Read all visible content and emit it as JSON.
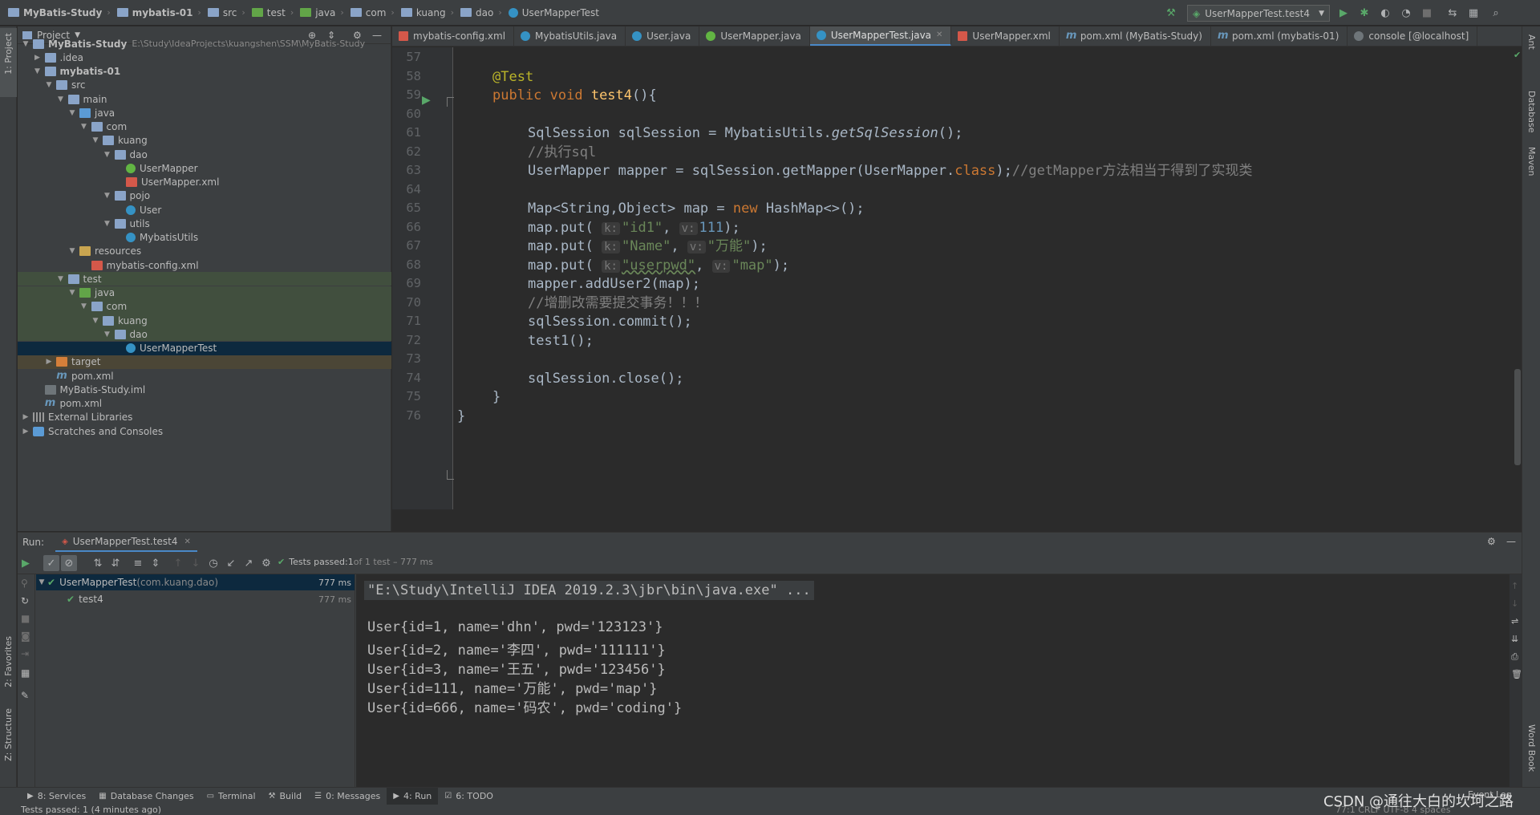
{
  "breadcrumbs": [
    {
      "label": "MyBatis-Study",
      "bold": true
    },
    {
      "label": "mybatis-01",
      "bold": true
    },
    {
      "label": "src"
    },
    {
      "label": "test"
    },
    {
      "label": "java"
    },
    {
      "label": "com"
    },
    {
      "label": "kuang"
    },
    {
      "label": "dao"
    },
    {
      "label": "UserMapperTest"
    }
  ],
  "run_config": "UserMapperTest.test4",
  "left_tabs": {
    "project": "1: Project",
    "favorites": "2: Favorites",
    "structure": "Z: Structure"
  },
  "right_tabs": {
    "ant": "Ant",
    "database": "Database",
    "maven": "Maven",
    "wordbook": "Word Book"
  },
  "project": {
    "header": "Project",
    "root_path": "E:\\Study\\IdeaProjects\\kuangshen\\SSM\\MyBatis-Study",
    "tree": [
      {
        "label": "MyBatis-Study",
        "depth": 0,
        "arrow": "down",
        "icon": "folder",
        "bold": true
      },
      {
        "label": ".idea",
        "depth": 1,
        "arrow": "right",
        "icon": "folder"
      },
      {
        "label": "mybatis-01",
        "depth": 1,
        "arrow": "down",
        "icon": "folder",
        "bold": true
      },
      {
        "label": "src",
        "depth": 2,
        "arrow": "down",
        "icon": "folder"
      },
      {
        "label": "main",
        "depth": 3,
        "arrow": "down",
        "icon": "folder"
      },
      {
        "label": "java",
        "depth": 4,
        "arrow": "down",
        "icon": "folder-src"
      },
      {
        "label": "com",
        "depth": 5,
        "arrow": "down",
        "icon": "folder"
      },
      {
        "label": "kuang",
        "depth": 6,
        "arrow": "down",
        "icon": "folder"
      },
      {
        "label": "dao",
        "depth": 7,
        "arrow": "down",
        "icon": "folder"
      },
      {
        "label": "UserMapper",
        "depth": 8,
        "arrow": "",
        "icon": "interface"
      },
      {
        "label": "UserMapper.xml",
        "depth": 8,
        "arrow": "",
        "icon": "xml"
      },
      {
        "label": "pojo",
        "depth": 7,
        "arrow": "down",
        "icon": "folder"
      },
      {
        "label": "User",
        "depth": 8,
        "arrow": "",
        "icon": "class"
      },
      {
        "label": "utils",
        "depth": 7,
        "arrow": "down",
        "icon": "folder"
      },
      {
        "label": "MybatisUtils",
        "depth": 8,
        "arrow": "",
        "icon": "class"
      },
      {
        "label": "resources",
        "depth": 4,
        "arrow": "down",
        "icon": "folder-res"
      },
      {
        "label": "mybatis-config.xml",
        "depth": 5,
        "arrow": "",
        "icon": "xml"
      },
      {
        "label": "test",
        "depth": 3,
        "arrow": "down",
        "icon": "folder",
        "hl": "green"
      },
      {
        "label": "java",
        "depth": 4,
        "arrow": "down",
        "icon": "folder-test",
        "hl": "green"
      },
      {
        "label": "com",
        "depth": 5,
        "arrow": "down",
        "icon": "folder",
        "hl": "green"
      },
      {
        "label": "kuang",
        "depth": 6,
        "arrow": "down",
        "icon": "folder",
        "hl": "green"
      },
      {
        "label": "dao",
        "depth": 7,
        "arrow": "down",
        "icon": "folder",
        "hl": "green"
      },
      {
        "label": "UserMapperTest",
        "depth": 8,
        "arrow": "",
        "icon": "class",
        "hl": "sel"
      },
      {
        "label": "target",
        "depth": 2,
        "arrow": "right",
        "icon": "folder-target",
        "hl": "brown"
      },
      {
        "label": "pom.xml",
        "depth": 2,
        "arrow": "",
        "icon": "maven"
      },
      {
        "label": "MyBatis-Study.iml",
        "depth": 1,
        "arrow": "",
        "icon": "iml"
      },
      {
        "label": "pom.xml",
        "depth": 1,
        "arrow": "",
        "icon": "maven"
      },
      {
        "label": "External Libraries",
        "depth": 0,
        "arrow": "right",
        "icon": "lib"
      },
      {
        "label": "Scratches and Consoles",
        "depth": 0,
        "arrow": "right",
        "icon": "scratch"
      }
    ]
  },
  "editor_tabs": [
    {
      "label": "mybatis-config.xml",
      "icon": "xml"
    },
    {
      "label": "MybatisUtils.java",
      "icon": "class"
    },
    {
      "label": "User.java",
      "icon": "class"
    },
    {
      "label": "UserMapper.java",
      "icon": "interface"
    },
    {
      "label": "UserMapperTest.java",
      "icon": "class",
      "active": true
    },
    {
      "label": "UserMapper.xml",
      "icon": "xml"
    },
    {
      "label": "pom.xml (MyBatis-Study)",
      "icon": "maven"
    },
    {
      "label": "pom.xml (mybatis-01)",
      "icon": "maven"
    },
    {
      "label": "console [@localhost]",
      "icon": "console"
    }
  ],
  "code": {
    "line_numbers": [
      "57",
      "58",
      "59",
      "60",
      "61",
      "62",
      "63",
      "64",
      "65",
      "66",
      "67",
      "68",
      "69",
      "70",
      "71",
      "72",
      "73",
      "74",
      "75",
      "76"
    ],
    "l58_annotation": "@Test",
    "l59_kw": "public void ",
    "l59_fn": "test4",
    "l59_rest": "(){",
    "l61_a": "SqlSession sqlSession = MybatisUtils.",
    "l61_it": "getSqlSession",
    "l61_b": "();",
    "l62_comment": "//执行sql",
    "l63_a": "UserMapper mapper = sqlSession.getMapper(UserMapper.",
    "l63_kw": "class",
    "l63_b": ");",
    "l63_comment": "//getMapper方法相当于得到了实现类",
    "l65_a": "Map<String,Object> map = ",
    "l65_kw": "new ",
    "l65_b": "HashMap<>();",
    "put_prefix": "map.put( ",
    "hint_k": "k:",
    "hint_v": "v:",
    "l66_k": "\"id1\"",
    "l66_v": "111",
    "l67_k": "\"Name\"",
    "l67_v": "\"万能\"",
    "l68_k": "\"userpwd\"",
    "l68_v": "\"map\"",
    "comma": ", ",
    "close_paren": ");",
    "l69": "mapper.addUser2(map);",
    "l70_comment": "//增删改需要提交事务！！！",
    "l71": "sqlSession.commit();",
    "l72": "test1();",
    "l74": "sqlSession.close();",
    "l75": "}",
    "l76": "}"
  },
  "run": {
    "label": "Run:",
    "tab": "UserMapperTest.test4",
    "status_prefix": "Tests passed: ",
    "status_count": "1",
    "status_suffix": " of 1 test – 777 ms",
    "tree": [
      {
        "label": "UserMapperTest",
        "sub": " (com.kuang.dao)",
        "time": "777 ms"
      },
      {
        "label": "test4",
        "sub": "",
        "time": "777 ms"
      }
    ],
    "console": [
      "\"E:\\Study\\IntelliJ IDEA 2019.2.3\\jbr\\bin\\java.exe\" ...",
      "",
      "User{id=1, name='dhn', pwd='123123'}",
      "User{id=2, name='李四', pwd='111111'}",
      "User{id=3, name='王五', pwd='123456'}",
      "User{id=111, name='万能', pwd='map'}",
      "User{id=666, name='码农', pwd='coding'}"
    ]
  },
  "bottom_tabs": [
    {
      "label": "8: Services"
    },
    {
      "label": "Database Changes"
    },
    {
      "label": "Terminal"
    },
    {
      "label": "Build"
    },
    {
      "label": "0: Messages"
    },
    {
      "label": "4: Run",
      "active": true
    },
    {
      "label": "6: TODO"
    }
  ],
  "event_log": "Event Log",
  "status_bar": {
    "message": "Tests passed: 1 (4 minutes ago)",
    "right": "77:1  CRLF  UTF-8  4 spaces"
  },
  "watermark": "CSDN @通往大白的坎坷之路"
}
